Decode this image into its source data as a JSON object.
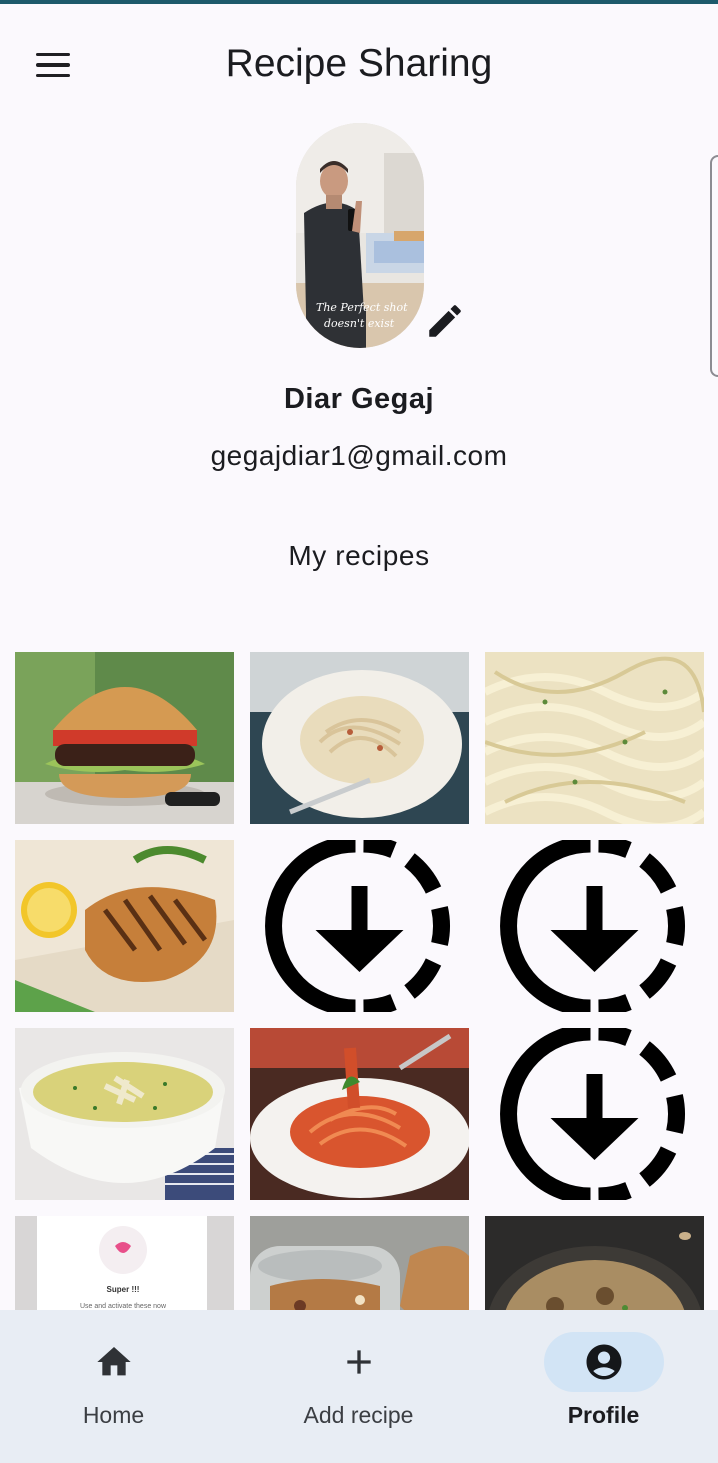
{
  "app": {
    "title": "Recipe Sharing"
  },
  "profile": {
    "name": "Diar Gegaj",
    "email": "gegajdiar1@gmail.com",
    "avatar_caption": "The Perfect shot doesn't exist"
  },
  "recipes_section": {
    "title": "My recipes"
  },
  "recipes": [
    {
      "image": "burger"
    },
    {
      "image": "pasta-plate"
    },
    {
      "image": "fettuccine-pan"
    },
    {
      "image": "grilled-chicken"
    },
    {
      "image": "download-placeholder"
    },
    {
      "image": "download-placeholder"
    },
    {
      "image": "soup-bowl"
    },
    {
      "image": "spaghetti-tomato"
    },
    {
      "image": "download-placeholder"
    },
    {
      "image": "app-screenshot"
    },
    {
      "image": "granola-jar"
    },
    {
      "image": "mushroom-risotto"
    }
  ],
  "recipe_preview_text": {
    "title": "Super !!!",
    "body": "Use and activate these now"
  },
  "nav": {
    "items": [
      {
        "label": "Home",
        "icon": "home-icon",
        "active": false
      },
      {
        "label": "Add recipe",
        "icon": "add-icon",
        "active": false
      },
      {
        "label": "Profile",
        "icon": "account-circle-icon",
        "active": true
      }
    ]
  },
  "colors": {
    "background": "#fbf9fd",
    "accent_top": "#1d5a6b",
    "nav_background": "#e8edf4",
    "nav_active_indicator": "#d2e4f5"
  }
}
